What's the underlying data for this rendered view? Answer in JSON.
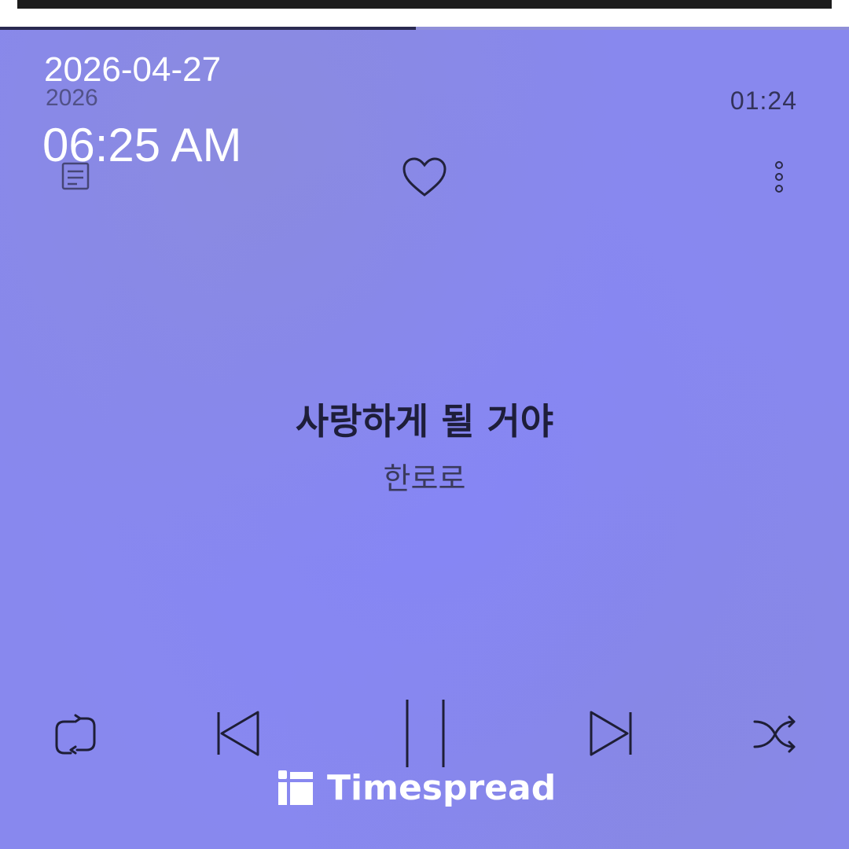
{
  "overlay": {
    "date": "2026-04-27",
    "time": "06:25 AM"
  },
  "player": {
    "elapsed": "2026",
    "duration": "01:24",
    "progress_fraction": 0.49,
    "song_title": "사랑하게 될 거야",
    "artist": "한로로",
    "accent_color": "#8888ee",
    "icons": {
      "playlist": "playlist-icon",
      "like": "heart-icon",
      "more": "more-vertical-icon",
      "repeat": "repeat-icon",
      "previous": "skip-previous-icon",
      "pause": "pause-icon",
      "next": "skip-next-icon",
      "shuffle": "shuffle-icon"
    }
  },
  "watermark": {
    "brand": "Timespread"
  }
}
